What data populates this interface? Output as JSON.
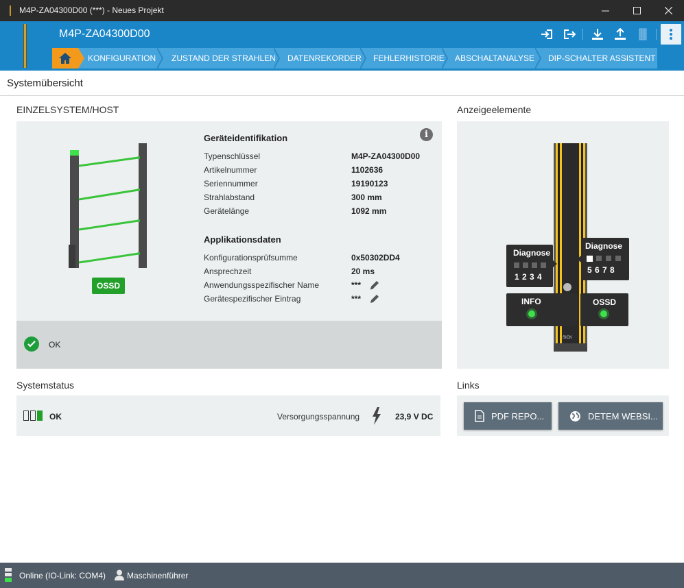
{
  "window": {
    "title": "M4P-ZA04300D00 (***) - Neues Projekt"
  },
  "header": {
    "device_name": "M4P-ZA04300D00",
    "tabs": [
      {
        "label": "KONFIGURATION"
      },
      {
        "label": "ZUSTAND DER STRAHLEN"
      },
      {
        "label": "DATENREKORDER"
      },
      {
        "label": "FEHLERHISTORIE"
      },
      {
        "label": "ABSCHALTANALYSE"
      },
      {
        "label": "DIP-SCHALTER ASSISTENT"
      }
    ]
  },
  "page": {
    "title": "Systemübersicht"
  },
  "system": {
    "section_title": "EINZELSYSTEM/HOST",
    "ossd_badge": "OSSD",
    "device_id": {
      "heading": "Geräteidentifikation",
      "rows": [
        {
          "label": "Typenschlüssel",
          "value": "M4P-ZA04300D00"
        },
        {
          "label": "Artikelnummer",
          "value": "1102636"
        },
        {
          "label": "Seriennummer",
          "value": "19190123"
        },
        {
          "label": "Strahlabstand",
          "value": "300 mm"
        },
        {
          "label": "Gerätelänge",
          "value": "1092 mm"
        }
      ]
    },
    "app_data": {
      "heading": "Applikationsdaten",
      "rows": [
        {
          "label": "Konfigurationsprüfsumme",
          "value": "0x50302DD4"
        },
        {
          "label": "Ansprechzeit",
          "value": "20 ms"
        },
        {
          "label": "Anwendungsspezifischer Name",
          "value": "***"
        },
        {
          "label": "Gerätespezifischer Eintrag",
          "value": "***"
        }
      ]
    },
    "status_text": "OK"
  },
  "display": {
    "section_title": "Anzeigeelemente",
    "diag_left_title": "Diagnose",
    "diag_left_nums": "1 2 3 4",
    "diag_right_title": "Diagnose",
    "diag_right_nums": "5 6 7 8",
    "info_label": "INFO",
    "ossd_label": "OSSD",
    "brand": "SICK"
  },
  "system_status": {
    "section_title": "Systemstatus",
    "status": "OK",
    "supply_label": "Versorgungsspannung",
    "supply_value": "23,9 V DC"
  },
  "links": {
    "section_title": "Links",
    "pdf_label": "PDF REPO...",
    "web_label": "DETEM WEBSI..."
  },
  "statusbar": {
    "connection": "Online (IO-Link: COM4)",
    "user": "Maschinenführer"
  },
  "colors": {
    "header_blue": "#1a86c8",
    "tab_blue": "#46a4dd",
    "home_orange": "#f39a1c",
    "ok_green": "#1e9e3a",
    "beam_green": "#39c43a"
  }
}
